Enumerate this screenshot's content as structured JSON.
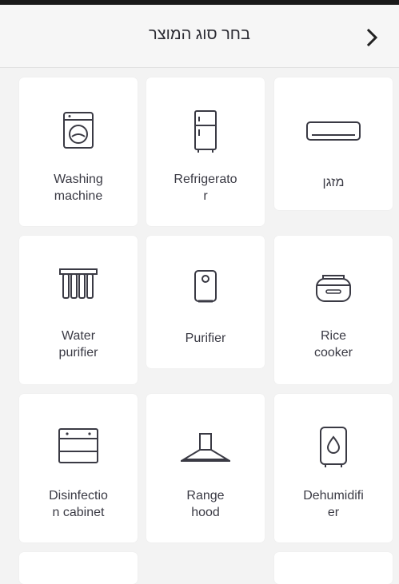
{
  "header": {
    "title": "בחר סוג המוצר",
    "back_icon": "chevron-right-icon"
  },
  "cards": [
    {
      "label": "Washing\nmachine",
      "icon": "washing-machine-icon"
    },
    {
      "label": "Refrigerato\nr",
      "icon": "refrigerator-icon"
    },
    {
      "label": "מזגן",
      "icon": "air-conditioner-icon"
    },
    {
      "label": "Water\npurifier",
      "icon": "water-purifier-icon"
    },
    {
      "label": "Purifier",
      "icon": "air-purifier-icon"
    },
    {
      "label": "Rice\ncooker",
      "icon": "rice-cooker-icon"
    },
    {
      "label": "Disinfectio\nn cabinet",
      "icon": "disinfection-cabinet-icon"
    },
    {
      "label": "Range\nhood",
      "icon": "range-hood-icon"
    },
    {
      "label": "Dehumidifi\ner",
      "icon": "dehumidifier-icon"
    }
  ]
}
